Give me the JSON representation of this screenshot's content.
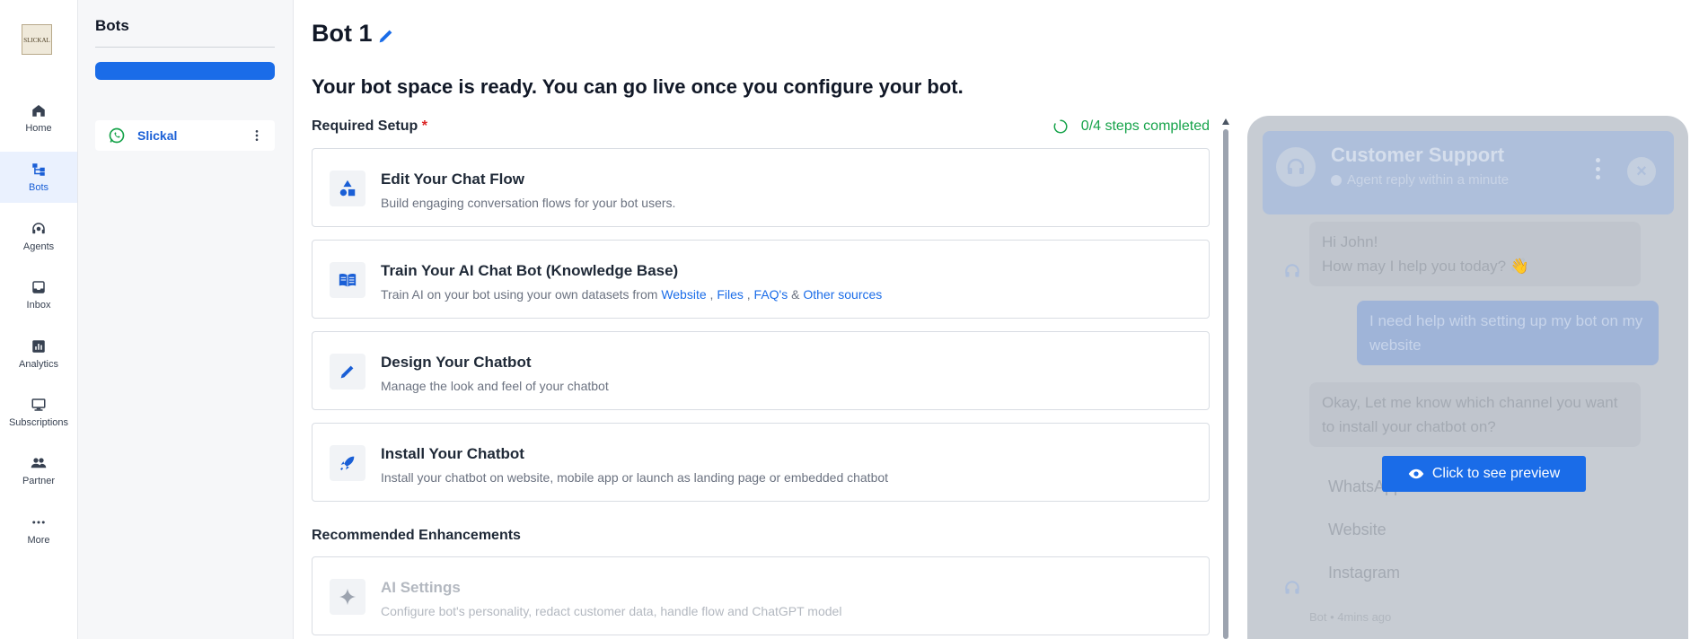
{
  "rail": {
    "logo_text": "SLICKAL",
    "items": [
      {
        "label": "Home",
        "icon": "home-icon"
      },
      {
        "label": "Bots",
        "icon": "bots-icon"
      },
      {
        "label": "Agents",
        "icon": "agents-icon"
      },
      {
        "label": "Inbox",
        "icon": "inbox-icon"
      },
      {
        "label": "Analytics",
        "icon": "analytics-icon"
      },
      {
        "label": "Subscriptions",
        "icon": "subscriptions-icon"
      },
      {
        "label": "Partner",
        "icon": "partner-icon"
      },
      {
        "label": "More",
        "icon": "more-icon"
      }
    ],
    "active": "Bots"
  },
  "bots_panel": {
    "title": "Bots",
    "bots": [
      {
        "name": "Slickal",
        "channel_icon": "whatsapp-icon"
      }
    ]
  },
  "main": {
    "title": "Bot 1",
    "headline": "Your bot space is ready. You can go live once you configure your bot.",
    "required_label": "Required Setup",
    "required_star": "*",
    "steps_text": "0/4 steps completed",
    "cards": [
      {
        "title": "Edit Your Chat Flow",
        "desc": "Build engaging conversation flows for your bot users.",
        "icon": "shapes-icon"
      },
      {
        "title": "Train Your AI Chat Bot (Knowledge Base)",
        "desc_prefix": "Train AI on your bot using your own datasets from ",
        "links": [
          "Website",
          "Files",
          "FAQ's",
          "Other sources"
        ],
        "sep1": " , ",
        "sep2": " , ",
        "sep3": " & ",
        "icon": "book-icon"
      },
      {
        "title": "Design Your Chatbot",
        "desc": "Manage the look and feel of your chatbot",
        "icon": "pencil-icon"
      },
      {
        "title": "Install Your Chatbot",
        "desc": "Install your chatbot on website, mobile app or launch as landing page or embedded chatbot",
        "icon": "rocket-icon"
      }
    ],
    "recommended_label": "Recommended Enhancements",
    "recommended": [
      {
        "title": "AI Settings",
        "desc": "Configure bot's personality, redact customer data, handle flow and ChatGPT model",
        "icon": "sparkle-icon"
      }
    ]
  },
  "preview": {
    "header_title": "Customer Support",
    "header_sub": "Agent reply within a minute",
    "bot_msg_1_line1": "Hi John!",
    "bot_msg_1_line2": "How may I help you today? 👋",
    "user_msg": "I need help with setting up my bot on my website",
    "bot_msg_2": "Okay, Let me know which channel you want to install your chatbot on?",
    "options": [
      "WhatsApp",
      "Website",
      "Instagram"
    ],
    "meta": "Bot • 4mins ago",
    "button_label": "Click to see preview"
  },
  "colors": {
    "accent": "#1a6ce8",
    "success": "#16a34a",
    "required": "#dc2626"
  }
}
